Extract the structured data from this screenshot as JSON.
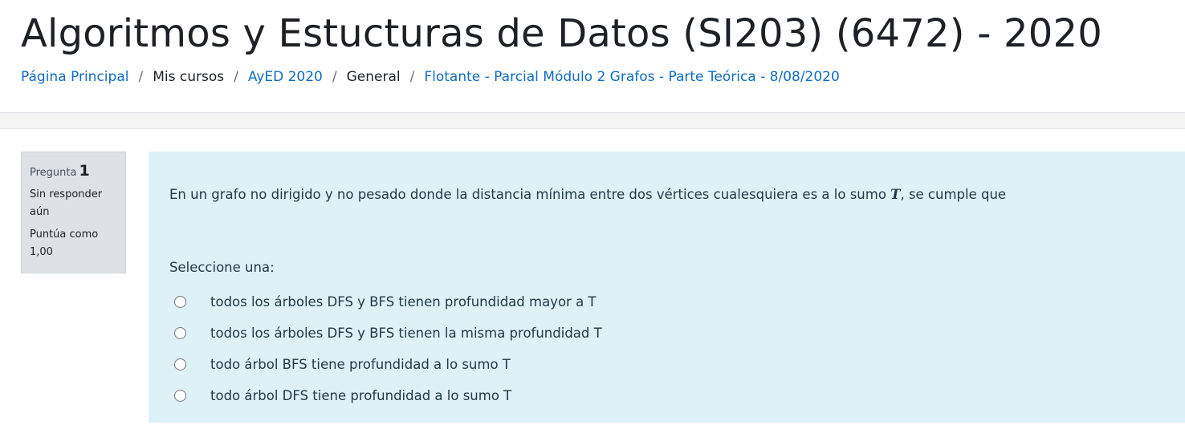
{
  "header": {
    "title": "Algoritmos y Estucturas de Datos (SI203) (6472) - 2020",
    "breadcrumb": [
      {
        "label": "Página Principal",
        "link": true
      },
      {
        "label": "Mis cursos",
        "link": false
      },
      {
        "label": "AyED 2020",
        "link": true
      },
      {
        "label": "General",
        "link": false
      },
      {
        "label": "Flotante - Parcial Módulo 2 Grafos - Parte Teórica - 8/08/2020",
        "link": true
      }
    ],
    "separator": "/"
  },
  "question": {
    "info": {
      "label": "Pregunta",
      "number": "1",
      "state": "Sin responder aún",
      "grade": "Puntúa como 1,00"
    },
    "text_before": "En un grafo no dirigido y no pesado donde la distancia mínima entre dos vértices cualesquiera es a lo sumo ",
    "variable": "T",
    "text_after": ",  se cumple que",
    "prompt": "Seleccione una:",
    "options": [
      {
        "label": "todos los árboles DFS y BFS tienen profundidad mayor a T",
        "selected": false
      },
      {
        "label": "todos los árboles DFS y BFS tienen la misma profundidad T",
        "selected": false
      },
      {
        "label": "todo árbol BFS tiene profundidad a lo sumo T",
        "selected": false
      },
      {
        "label": "todo árbol DFS tiene profundidad a lo sumo T",
        "selected": false
      }
    ]
  },
  "colors": {
    "link": "#0f6cbf",
    "content_bg": "#def1f7",
    "info_bg": "#dee2e6"
  }
}
